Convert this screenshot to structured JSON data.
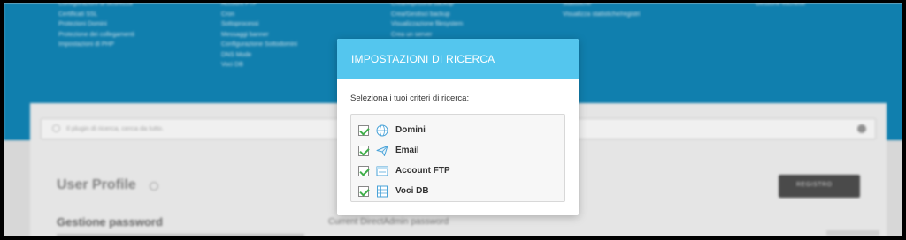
{
  "modal": {
    "title": "IMPOSTAZIONI DI RICERCA",
    "prompt": "Seleziona i tuoi criteri di ricerca:",
    "options": [
      {
        "label": "Domini",
        "icon": "globe-icon",
        "checked": true
      },
      {
        "label": "Email",
        "icon": "paper-plane-icon",
        "checked": true
      },
      {
        "label": "Account FTP",
        "icon": "ftp-window-icon",
        "checked": true
      },
      {
        "label": "Voci DB",
        "icon": "database-table-icon",
        "checked": true
      }
    ]
  },
  "background": {
    "menu_columns": [
      [
        "Configurazioni di sicurezza",
        "Certificati SSL",
        "Protezioni Domini",
        "Protezione dei collegamenti",
        "Impostazioni di PHP"
      ],
      [
        "Account FTP",
        "Cron",
        "Sottoprocessi",
        "Messaggi banner",
        "Configurazione Sottodomini",
        "DNS Mode",
        "Voci DB"
      ],
      [
        "Crea/Ripristina backup",
        "Crea/Gestisci backup",
        "Visualizzazione filesystem",
        "Crea un server"
      ],
      [
        "Statistiche",
        "Visualizza statistiche/registri"
      ],
      [
        "Gestione etichette"
      ]
    ],
    "search_placeholder": "Il plugin di ricerca, cerca da tutto.",
    "page_title": "User Profile",
    "section_title": "Gestione password",
    "field_label": "Current DirectAdmin password",
    "button_label": "REGISTRO"
  },
  "colors": {
    "header_blue": "#1287b9",
    "modal_header": "#54c6ee",
    "check_green": "#3fae49",
    "icon_blue": "#4aa3d8"
  }
}
